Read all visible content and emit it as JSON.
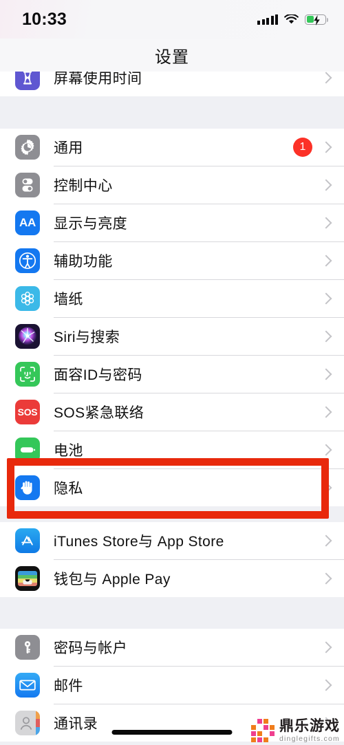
{
  "status_bar": {
    "time": "10:33",
    "signal_icon": "cellular-signal-icon",
    "wifi_icon": "wifi-icon",
    "battery_icon": "battery-charging-icon",
    "battery_level_percent": 42
  },
  "nav": {
    "title": "设置"
  },
  "colors": {
    "accent_blue": "#1478f0",
    "badge_red": "#fc3127",
    "annotation_red": "#e8290c",
    "separator": "#d8d8dc",
    "group_background": "#ffffff",
    "page_background": "#eff0f4"
  },
  "annotation": {
    "shape": "rectangle",
    "color": "#e8290c",
    "targets_row": "隐私"
  },
  "sections": [
    {
      "name": "screen-time-section",
      "rows": [
        {
          "label": "屏幕使用时间",
          "icon": "hourglass-icon",
          "icon_class": "ic-screentime",
          "badge": null,
          "chevron": true,
          "clipped_top": true
        }
      ]
    },
    {
      "name": "system-settings-section",
      "rows": [
        {
          "label": "通用",
          "icon": "gear-icon",
          "icon_class": "ic-general",
          "badge": "1",
          "chevron": true
        },
        {
          "label": "控制中心",
          "icon": "toggles-icon",
          "icon_class": "ic-control",
          "badge": null,
          "chevron": true
        },
        {
          "label": "显示与亮度",
          "icon": "text-size-aa-icon",
          "icon_class": "ic-display",
          "badge": null,
          "chevron": true
        },
        {
          "label": "辅助功能",
          "icon": "accessibility-person-icon",
          "icon_class": "ic-access",
          "badge": null,
          "chevron": true
        },
        {
          "label": "墙纸",
          "icon": "flower-wallpaper-icon",
          "icon_class": "ic-wallpaper",
          "badge": null,
          "chevron": true
        },
        {
          "label": "Siri与搜索",
          "icon": "siri-orb-icon",
          "icon_class": "ic-siri",
          "badge": null,
          "chevron": true
        },
        {
          "label": "面容ID与密码",
          "icon": "face-id-icon",
          "icon_class": "ic-faceid",
          "badge": null,
          "chevron": true
        },
        {
          "label": "SOS紧急联络",
          "icon": "sos-icon",
          "icon_class": "ic-sos",
          "badge": null,
          "chevron": true
        },
        {
          "label": "电池",
          "icon": "battery-icon",
          "icon_class": "ic-battery",
          "badge": null,
          "chevron": true
        },
        {
          "label": "隐私",
          "icon": "privacy-hand-icon",
          "icon_class": "ic-privacy",
          "badge": null,
          "chevron": true,
          "highlighted": true
        }
      ]
    },
    {
      "name": "stores-section",
      "rows": [
        {
          "label": "iTunes Store与 App Store",
          "icon": "app-store-icon",
          "icon_class": "ic-appstore",
          "badge": null,
          "chevron": true
        },
        {
          "label": "钱包与 Apple Pay",
          "icon": "wallet-icon",
          "icon_class": "ic-wallet",
          "badge": null,
          "chevron": true
        }
      ]
    },
    {
      "name": "accounts-section",
      "rows": [
        {
          "label": "密码与帐户",
          "icon": "key-icon",
          "icon_class": "ic-passwords",
          "badge": null,
          "chevron": true
        },
        {
          "label": "邮件",
          "icon": "mail-envelope-icon",
          "icon_class": "ic-mail",
          "badge": null,
          "chevron": true
        },
        {
          "label": "通讯录",
          "icon": "contacts-icon",
          "icon_class": "ic-contacts",
          "badge": null,
          "chevron": true
        }
      ]
    }
  ],
  "watermark": {
    "title": "鼎乐游戏",
    "subtitle": "dinglegifts.com",
    "logo_icon": "pixel-grid-logo-icon"
  }
}
